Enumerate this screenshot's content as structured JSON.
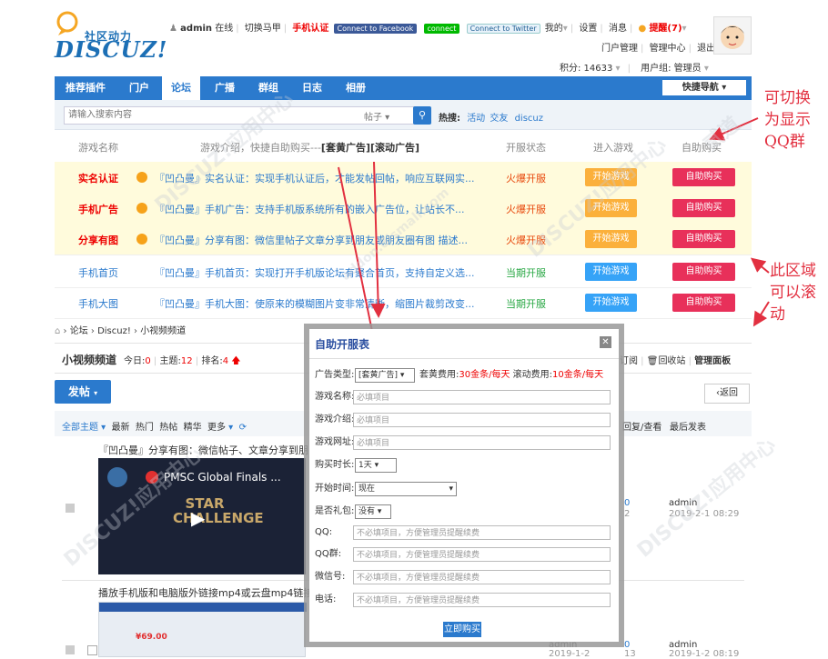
{
  "header": {
    "logo_cn": "社区动力",
    "logo_en": "DISCUZ!",
    "username": "admin",
    "online": "在线",
    "switch_vest": "切换马甲",
    "phone_verify": "手机认证",
    "fb_connect": "Connect to Facebook",
    "line_connect": "connect",
    "twitter_connect": "Connect to Twitter",
    "mine": "我的",
    "settings": "设置",
    "messages": "消息",
    "reminder": "提醒(7)",
    "portal_manage": "门户管理",
    "admin_center": "管理中心",
    "logout": "退出",
    "points": "积分: 14633",
    "usergroup": "用户组: 管理员"
  },
  "nav": {
    "items": [
      "推荐插件",
      "门户",
      "论坛",
      "广播",
      "群组",
      "日志",
      "相册"
    ],
    "quick_nav": "快捷导航"
  },
  "search": {
    "placeholder": "请输入搜索内容",
    "type": "帖子",
    "hot_label": "热搜:",
    "hot_words": [
      "活动",
      "交友",
      "discuz"
    ]
  },
  "game_table": {
    "headers": {
      "name": "游戏名称",
      "intro": "游戏介绍，快捷自助购买---",
      "intro_tags": "[套黄广告][滚动广告]",
      "status": "开服状态",
      "enter": "进入游戏",
      "buy": "自助购买"
    },
    "rows": [
      {
        "name": "实名认证",
        "desc": "『凹凸曼』实名认证：实现手机认证后，才能发帖回帖，响应互联网实...",
        "status": "火爆开服",
        "start": "开始游戏",
        "buy": "自助购买"
      },
      {
        "name": "手机广告",
        "desc": "『凹凸曼』手机广告：支持手机版系统所有的嵌入广告位，让站长不...",
        "status": "火爆开服",
        "start": "开始游戏",
        "buy": "自助购买"
      },
      {
        "name": "分享有图",
        "desc": "『凹凸曼』分享有图：微信里帖子文章分享到朋友或朋友圈有图 描述...",
        "status": "火爆开服",
        "start": "开始游戏",
        "buy": "自助购买"
      },
      {
        "name": "手机首页",
        "desc": "『凹凸曼』手机首页：实现打开手机版论坛有聚合首页，支持自定义选...",
        "status": "当期开服",
        "start": "开始游戏",
        "buy": "自助购买"
      },
      {
        "name": "手机大图",
        "desc": "『凹凸曼』手机大图：使原来的模糊图片变非常清晰，缩图片裁剪改变...",
        "status": "当期开服",
        "start": "开始游戏",
        "buy": "自助购买"
      }
    ]
  },
  "annotations": {
    "a1": "可切换\n为显示\nQQ群",
    "a2": "此区域\n可以滚\n动"
  },
  "forum": {
    "crumbs": [
      "论坛",
      "Discuz!",
      "小视频频道"
    ],
    "name": "小视频频道",
    "today_label": "今日:",
    "today": "0",
    "topics_label": "主题:",
    "topics": "12",
    "rank_label": "排名:",
    "rank": "4",
    "subscribe": "订阅",
    "recycle": "回收站",
    "admin_panel": "管理面板",
    "post_btn": "发帖",
    "back_btn": "返回",
    "filters": [
      "全部主题",
      "最新",
      "热门",
      "热帖",
      "精华",
      "更多"
    ],
    "reply_view": "回复/查看",
    "last_post": "最后发表",
    "posts": [
      {
        "title": "『凹凸曼』分享有图：微信帖子、文章分享到朋",
        "video_title": "PMSC Global Finals ...",
        "video_text": "STAR CHALLENGE",
        "replies": "0",
        "views": "2",
        "last_user": "admin",
        "last_time": "2019-2-1 08:29"
      },
      {
        "title": "播放手机版和电脑版外链接mp4或云盘mp4链接",
        "author": "admin",
        "author_date": "2019-1-2",
        "replies": "0",
        "views": "13",
        "last_user": "admin",
        "last_time": "2019-1-2 08:19",
        "price_text": "¥69.00"
      }
    ]
  },
  "modal": {
    "title": "自助开服表",
    "ad_type_label": "广告类型:",
    "ad_type_value": "[套黄广告]",
    "fee_text1": "套黄费用:",
    "fee_value1": "30金条/每天",
    "fee_text2": "滚动费用:",
    "fee_value2": "10金条/每天",
    "game_name_label": "游戏名称:",
    "game_intro_label": "游戏介绍:",
    "game_url_label": "游戏网址:",
    "required": "必填项目",
    "duration_label": "购买时长:",
    "duration_value": "1天",
    "start_label": "开始时间:",
    "start_value": "现在",
    "gift_label": "是否礼包:",
    "gift_value": "没有",
    "qq_label": "QQ:",
    "qqgroup_label": "QQ群:",
    "wechat_label": "微信号:",
    "phone_label": "电话:",
    "optional": "不必填项目，方便管理员提醒续费",
    "submit": "立即购买"
  },
  "watermark": [
    "DISCUZ!应用中心",
    "addon.dismall.com",
    "贰道"
  ],
  "colors": {
    "accent": "#2b7acd",
    "buy": "#e8305a",
    "start_orange": "#fbb03b",
    "start_blue": "#36a3f7",
    "hot": "#e8480c",
    "current": "#2aa845"
  }
}
